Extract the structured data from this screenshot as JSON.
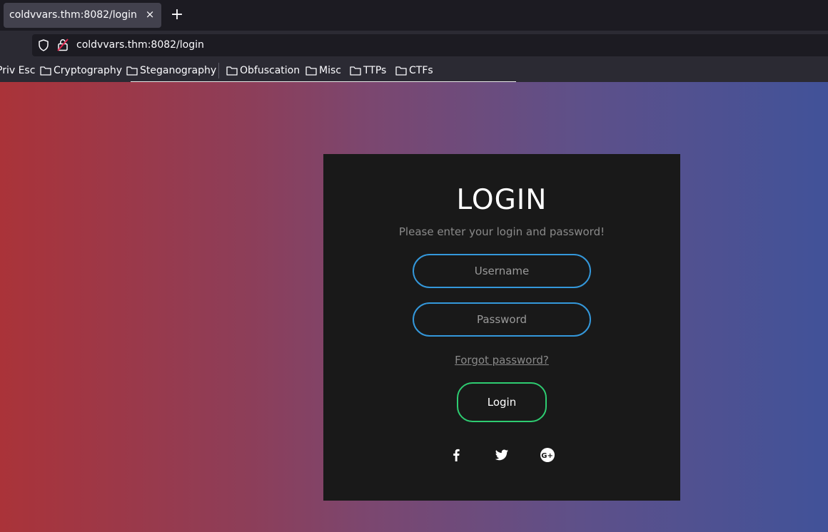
{
  "browser": {
    "tab": {
      "title": "coldvvars.thm:8082/login",
      "close_glyph": "×"
    },
    "new_tab_glyph": "+",
    "address": "coldvvars.thm:8082/login",
    "bookmarks": [
      {
        "label": "Priv Esc"
      },
      {
        "label": "Cryptography"
      },
      {
        "label": "Steganography"
      },
      {
        "label": "Obfuscation"
      },
      {
        "label": "Misc"
      },
      {
        "label": "TTPs"
      },
      {
        "label": "CTFs"
      }
    ]
  },
  "login": {
    "title": "LOGIN",
    "subtitle": "Please enter your login and password!",
    "username_placeholder": "Username",
    "password_placeholder": "Password",
    "forgot_label": "Forgot password?",
    "submit_label": "Login",
    "social_icons": [
      "facebook-icon",
      "twitter-icon",
      "google-plus-icon"
    ]
  },
  "colors": {
    "card_bg": "#191919",
    "input_border": "#3498db",
    "button_border": "#2ecc71",
    "gradient_left": "#aa3339",
    "gradient_right": "#415299"
  }
}
